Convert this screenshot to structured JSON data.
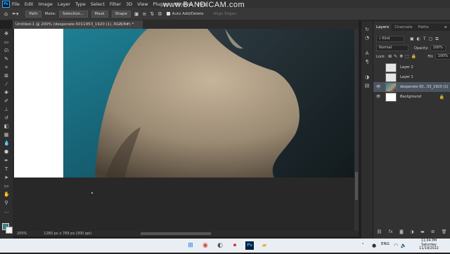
{
  "menubar": {
    "app_icon": "Ps",
    "items": [
      "File",
      "Edit",
      "Image",
      "Layer",
      "Type",
      "Select",
      "Filter",
      "3D",
      "View",
      "Plugins",
      "Window",
      "Help"
    ]
  },
  "watermark": "www.BANDICAM.com",
  "options": {
    "mode": "Path",
    "make_label": "Make:",
    "selection_btn": "Selection...",
    "mask_btn": "Mask",
    "shape_btn": "Shape",
    "auto_add_delete": "Auto Add/Delete",
    "align_edges": "Align Edges"
  },
  "document": {
    "tab_title": "Untitled-1 @ 200% (desperate-5011953_1920 (1), RGB/8#) *",
    "zoom": "200%",
    "size": "1280 px x 769 px (300 ppi)"
  },
  "panels": {
    "tabs": [
      "Layers",
      "Channels",
      "Paths"
    ],
    "kind": "Kind",
    "blend_mode": "Normal",
    "opacity_label": "Opacity:",
    "opacity_value": "100%",
    "lock_label": "Lock:",
    "fill_label": "Fill:",
    "fill_value": "100%",
    "layers": [
      {
        "name": "Layer 2",
        "visible": false
      },
      {
        "name": "Layer 1",
        "visible": false
      },
      {
        "name": "desperate-50...53_1920 (1)",
        "visible": true,
        "selected": true
      },
      {
        "name": "Background",
        "visible": true,
        "locked": true
      }
    ]
  },
  "taskbar": {
    "language": "ENG",
    "time": "11:04 PM",
    "day": "Saturday",
    "date": "11/19/2022"
  },
  "colors": {
    "foreground": "#3d7d8c",
    "background": "#ffffff",
    "selected_layer": "#4b5560"
  }
}
